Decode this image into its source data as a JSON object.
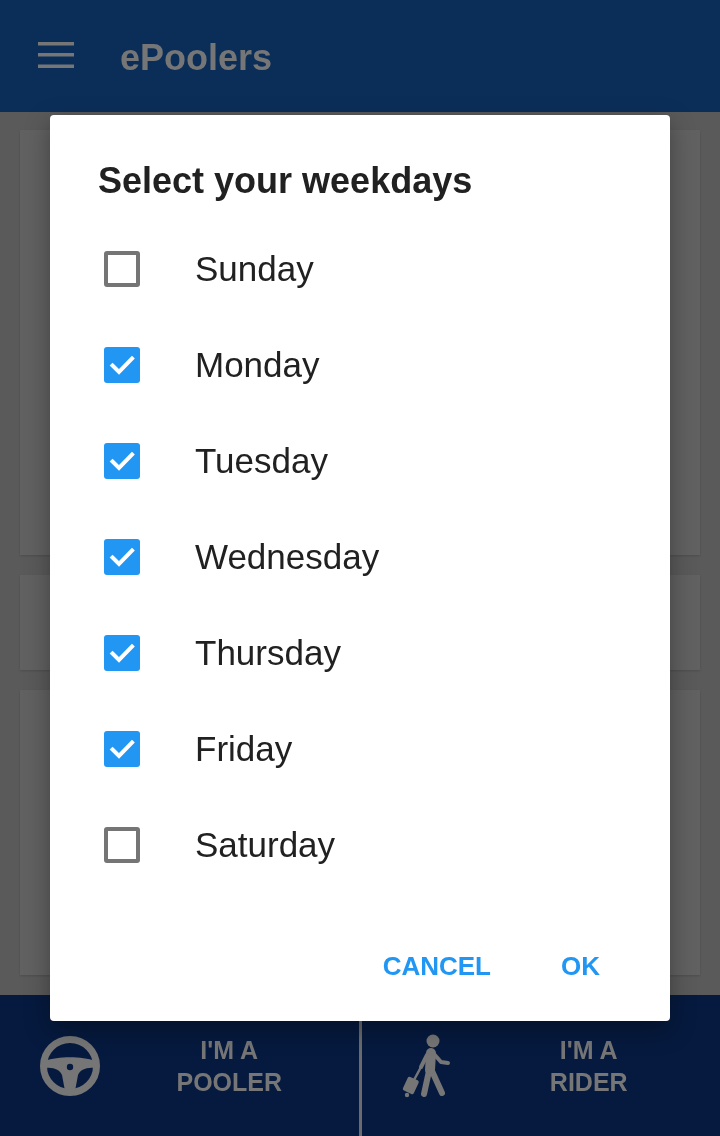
{
  "app_bar": {
    "title": "ePoolers"
  },
  "dialog": {
    "title": "Select your weekdays",
    "options": [
      {
        "label": "Sunday",
        "checked": false
      },
      {
        "label": "Monday",
        "checked": true
      },
      {
        "label": "Tuesday",
        "checked": true
      },
      {
        "label": "Wednesday",
        "checked": true
      },
      {
        "label": "Thursday",
        "checked": true
      },
      {
        "label": "Friday",
        "checked": true
      },
      {
        "label": "Saturday",
        "checked": false
      }
    ],
    "buttons": [
      "CANCEL",
      "OK"
    ]
  },
  "bottom_nav": [
    {
      "label": "I'M A POOLER",
      "kind": "wheel"
    },
    {
      "label": "I'M A RIDER",
      "kind": "walker"
    }
  ]
}
